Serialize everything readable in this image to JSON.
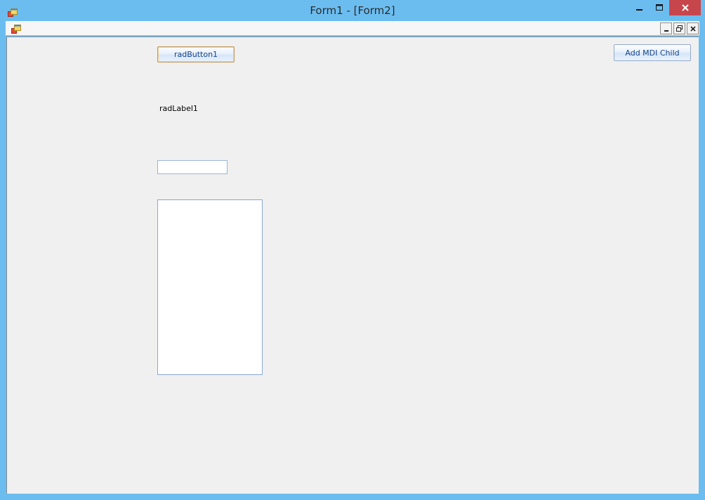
{
  "window": {
    "title": "Form1 - [Form2]",
    "title_color": "#2b2b2b",
    "border_color": "#6bbdf0",
    "close_button_color": "#c7464c",
    "icons": {
      "app": "app-windows-icon",
      "minimize": "minimize-icon",
      "maximize": "maximize-icon",
      "close": "close-icon"
    }
  },
  "mdi_strip": {
    "icons": {
      "child": "mdi-child-form-icon",
      "minimize": "mdi-minimize-icon",
      "restore": "mdi-restore-icon",
      "close": "mdi-close-icon"
    }
  },
  "form": {
    "background": "#f0f0f0",
    "rad_button1": {
      "label": "radButton1"
    },
    "rad_label1": {
      "text": "radLabel1"
    },
    "rad_textbox": {
      "value": "",
      "placeholder": ""
    },
    "rad_listbox": {
      "items": []
    },
    "add_mdi_child": {
      "label": "Add MDI Child"
    },
    "accent": "#15428b"
  }
}
